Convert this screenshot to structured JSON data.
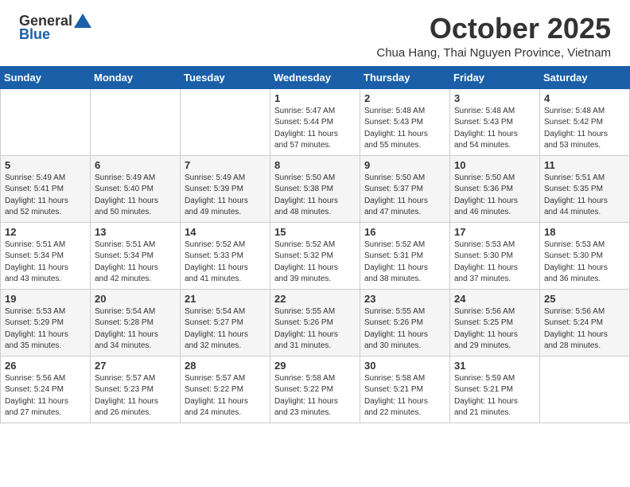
{
  "logo": {
    "general": "General",
    "blue": "Blue"
  },
  "header": {
    "month": "October 2025",
    "location": "Chua Hang, Thai Nguyen Province, Vietnam"
  },
  "weekdays": [
    "Sunday",
    "Monday",
    "Tuesday",
    "Wednesday",
    "Thursday",
    "Friday",
    "Saturday"
  ],
  "weeks": [
    [
      {
        "day": "",
        "info": ""
      },
      {
        "day": "",
        "info": ""
      },
      {
        "day": "",
        "info": ""
      },
      {
        "day": "1",
        "info": "Sunrise: 5:47 AM\nSunset: 5:44 PM\nDaylight: 11 hours\nand 57 minutes."
      },
      {
        "day": "2",
        "info": "Sunrise: 5:48 AM\nSunset: 5:43 PM\nDaylight: 11 hours\nand 55 minutes."
      },
      {
        "day": "3",
        "info": "Sunrise: 5:48 AM\nSunset: 5:43 PM\nDaylight: 11 hours\nand 54 minutes."
      },
      {
        "day": "4",
        "info": "Sunrise: 5:48 AM\nSunset: 5:42 PM\nDaylight: 11 hours\nand 53 minutes."
      }
    ],
    [
      {
        "day": "5",
        "info": "Sunrise: 5:49 AM\nSunset: 5:41 PM\nDaylight: 11 hours\nand 52 minutes."
      },
      {
        "day": "6",
        "info": "Sunrise: 5:49 AM\nSunset: 5:40 PM\nDaylight: 11 hours\nand 50 minutes."
      },
      {
        "day": "7",
        "info": "Sunrise: 5:49 AM\nSunset: 5:39 PM\nDaylight: 11 hours\nand 49 minutes."
      },
      {
        "day": "8",
        "info": "Sunrise: 5:50 AM\nSunset: 5:38 PM\nDaylight: 11 hours\nand 48 minutes."
      },
      {
        "day": "9",
        "info": "Sunrise: 5:50 AM\nSunset: 5:37 PM\nDaylight: 11 hours\nand 47 minutes."
      },
      {
        "day": "10",
        "info": "Sunrise: 5:50 AM\nSunset: 5:36 PM\nDaylight: 11 hours\nand 46 minutes."
      },
      {
        "day": "11",
        "info": "Sunrise: 5:51 AM\nSunset: 5:35 PM\nDaylight: 11 hours\nand 44 minutes."
      }
    ],
    [
      {
        "day": "12",
        "info": "Sunrise: 5:51 AM\nSunset: 5:34 PM\nDaylight: 11 hours\nand 43 minutes."
      },
      {
        "day": "13",
        "info": "Sunrise: 5:51 AM\nSunset: 5:34 PM\nDaylight: 11 hours\nand 42 minutes."
      },
      {
        "day": "14",
        "info": "Sunrise: 5:52 AM\nSunset: 5:33 PM\nDaylight: 11 hours\nand 41 minutes."
      },
      {
        "day": "15",
        "info": "Sunrise: 5:52 AM\nSunset: 5:32 PM\nDaylight: 11 hours\nand 39 minutes."
      },
      {
        "day": "16",
        "info": "Sunrise: 5:52 AM\nSunset: 5:31 PM\nDaylight: 11 hours\nand 38 minutes."
      },
      {
        "day": "17",
        "info": "Sunrise: 5:53 AM\nSunset: 5:30 PM\nDaylight: 11 hours\nand 37 minutes."
      },
      {
        "day": "18",
        "info": "Sunrise: 5:53 AM\nSunset: 5:30 PM\nDaylight: 11 hours\nand 36 minutes."
      }
    ],
    [
      {
        "day": "19",
        "info": "Sunrise: 5:53 AM\nSunset: 5:29 PM\nDaylight: 11 hours\nand 35 minutes."
      },
      {
        "day": "20",
        "info": "Sunrise: 5:54 AM\nSunset: 5:28 PM\nDaylight: 11 hours\nand 34 minutes."
      },
      {
        "day": "21",
        "info": "Sunrise: 5:54 AM\nSunset: 5:27 PM\nDaylight: 11 hours\nand 32 minutes."
      },
      {
        "day": "22",
        "info": "Sunrise: 5:55 AM\nSunset: 5:26 PM\nDaylight: 11 hours\nand 31 minutes."
      },
      {
        "day": "23",
        "info": "Sunrise: 5:55 AM\nSunset: 5:26 PM\nDaylight: 11 hours\nand 30 minutes."
      },
      {
        "day": "24",
        "info": "Sunrise: 5:56 AM\nSunset: 5:25 PM\nDaylight: 11 hours\nand 29 minutes."
      },
      {
        "day": "25",
        "info": "Sunrise: 5:56 AM\nSunset: 5:24 PM\nDaylight: 11 hours\nand 28 minutes."
      }
    ],
    [
      {
        "day": "26",
        "info": "Sunrise: 5:56 AM\nSunset: 5:24 PM\nDaylight: 11 hours\nand 27 minutes."
      },
      {
        "day": "27",
        "info": "Sunrise: 5:57 AM\nSunset: 5:23 PM\nDaylight: 11 hours\nand 26 minutes."
      },
      {
        "day": "28",
        "info": "Sunrise: 5:57 AM\nSunset: 5:22 PM\nDaylight: 11 hours\nand 24 minutes."
      },
      {
        "day": "29",
        "info": "Sunrise: 5:58 AM\nSunset: 5:22 PM\nDaylight: 11 hours\nand 23 minutes."
      },
      {
        "day": "30",
        "info": "Sunrise: 5:58 AM\nSunset: 5:21 PM\nDaylight: 11 hours\nand 22 minutes."
      },
      {
        "day": "31",
        "info": "Sunrise: 5:59 AM\nSunset: 5:21 PM\nDaylight: 11 hours\nand 21 minutes."
      },
      {
        "day": "",
        "info": ""
      }
    ]
  ]
}
